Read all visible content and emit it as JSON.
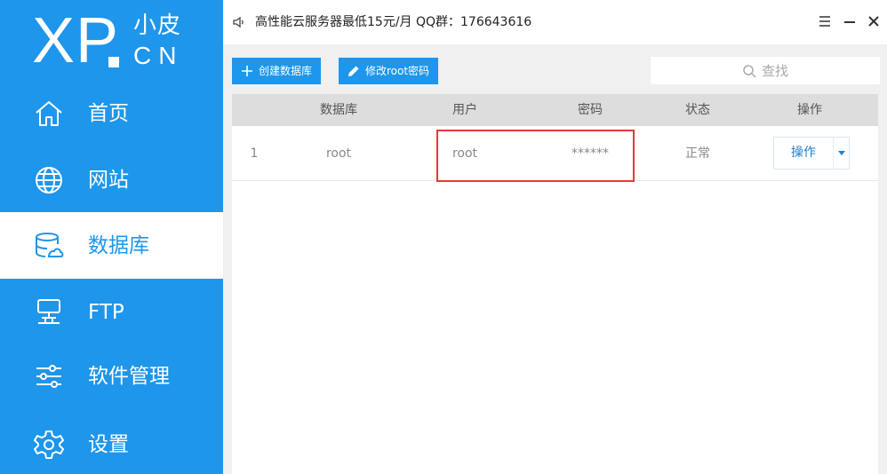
{
  "logo": {
    "brand": "XP",
    "cn_name": "小皮",
    "domain": "CN"
  },
  "sidebar": {
    "items": [
      {
        "label": "首页",
        "icon": "home-icon"
      },
      {
        "label": "网站",
        "icon": "globe-icon"
      },
      {
        "label": "数据库",
        "icon": "database-icon",
        "active": true
      },
      {
        "label": "FTP",
        "icon": "server-icon"
      },
      {
        "label": "软件管理",
        "icon": "sliders-icon"
      },
      {
        "label": "设置",
        "icon": "gear-icon"
      }
    ]
  },
  "topbar": {
    "notice": "高性能云服务器最低15元/月  QQ群：176643616",
    "controls": [
      "menu-icon",
      "minimize-icon",
      "close-icon"
    ]
  },
  "toolbar": {
    "create_label": "创建数据库",
    "change_pwd_label": "修改root密码",
    "search_placeholder": "查找"
  },
  "table": {
    "headers": [
      "数据库",
      "用户",
      "密码",
      "状态",
      "操作"
    ],
    "rows": [
      {
        "index": "1",
        "database": "root",
        "user": "root",
        "password": "******",
        "status": "正常",
        "action": "操作"
      }
    ]
  },
  "colors": {
    "primary": "#1e96eb",
    "highlight": "#e53935"
  }
}
